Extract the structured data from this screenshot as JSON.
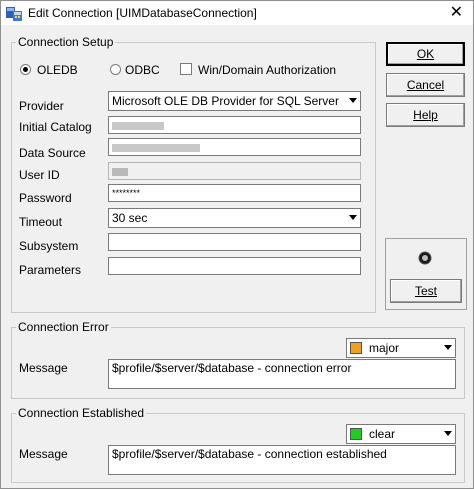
{
  "window": {
    "title": "Edit Connection [UIMDatabaseConnection]",
    "close_glyph": "✕",
    "icon": "database-connection-icon"
  },
  "connection_setup": {
    "group_label": "Connection Setup",
    "oledb_label": "OLEDB",
    "odbc_label": "ODBC",
    "win_auth_label": "Win/Domain Authorization",
    "selected_type": "OLEDB",
    "win_auth_checked": false,
    "fields": {
      "provider": {
        "label": "Provider",
        "value": "Microsoft OLE DB Provider for SQL Server"
      },
      "initial_catalog": {
        "label": "Initial Catalog",
        "value": ""
      },
      "data_source": {
        "label": "Data Source",
        "value": ""
      },
      "user_id": {
        "label": "User ID",
        "value": ""
      },
      "password": {
        "label": "Password",
        "value": "********"
      },
      "timeout": {
        "label": "Timeout",
        "value": "30 sec"
      },
      "subsystem": {
        "label": "Subsystem",
        "value": ""
      },
      "parameters": {
        "label": "Parameters",
        "value": ""
      }
    }
  },
  "buttons": {
    "ok": "OK",
    "cancel": "Cancel",
    "help": "Help",
    "test": "Test"
  },
  "connection_error": {
    "group_label": "Connection Error",
    "severity": "major",
    "severity_color": "#f0a020",
    "message_label": "Message",
    "message": "$profile/$server/$database - connection error"
  },
  "connection_established": {
    "group_label": "Connection Established",
    "severity": "clear",
    "severity_color": "#22cc22",
    "message_label": "Message",
    "message": "$profile/$server/$database - connection established"
  }
}
